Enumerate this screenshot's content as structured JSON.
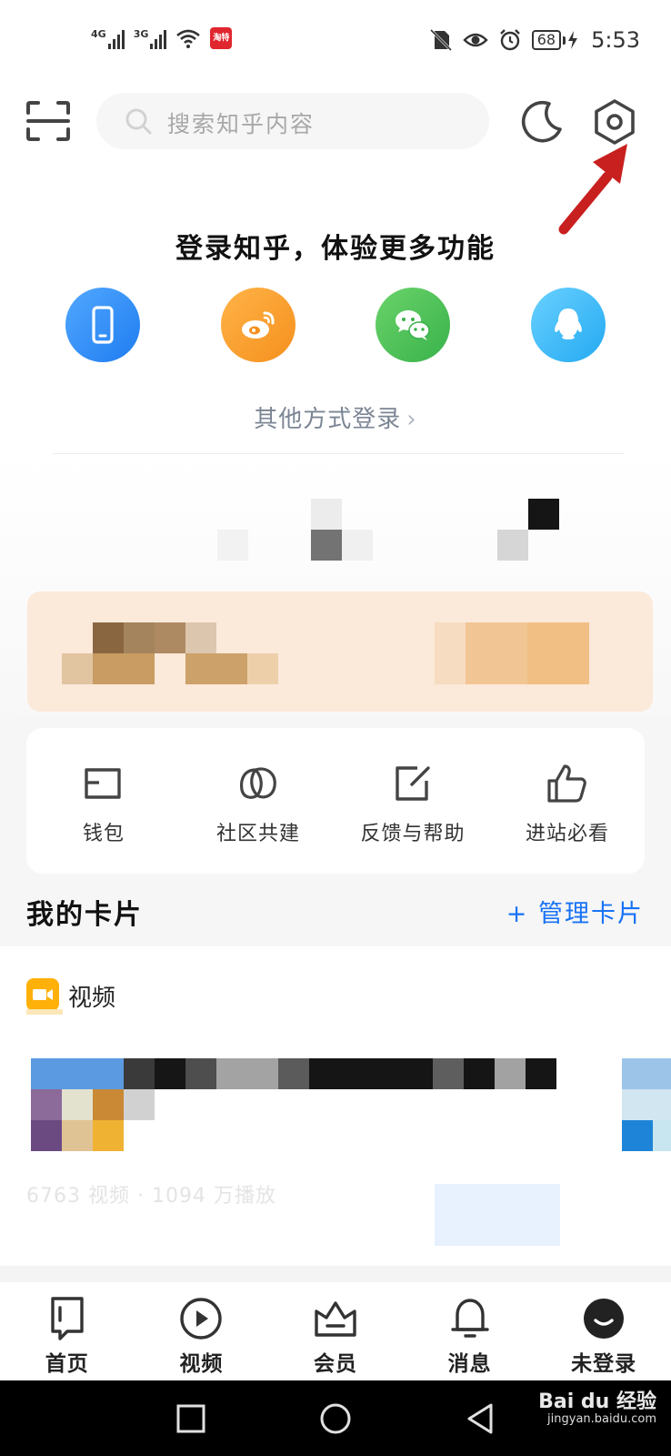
{
  "status_bar": {
    "network_1": "4G",
    "network_2": "3G",
    "app_notification": "淘特",
    "battery": "68",
    "time": "5:53"
  },
  "header": {
    "search_placeholder": "搜索知乎内容",
    "icons": [
      "scan-icon",
      "search-icon",
      "night-mode-icon",
      "settings-icon"
    ]
  },
  "login": {
    "title": "登录知乎，体验更多功能",
    "methods": [
      "phone-icon",
      "weibo-icon",
      "wechat-icon",
      "qq-icon"
    ],
    "other_login": "其他方式登录",
    "other_login_chevron": "›"
  },
  "quick_actions": [
    {
      "label": "钱包",
      "icon": "wallet-icon"
    },
    {
      "label": "社区共建",
      "icon": "community-icon"
    },
    {
      "label": "反馈与帮助",
      "icon": "feedback-icon"
    },
    {
      "label": "进站必看",
      "icon": "thumbs-up-icon"
    }
  ],
  "cards": {
    "title": "我的卡片",
    "manage": "+ 管理卡片",
    "video_card": {
      "label": "视频",
      "stats": "6763 视频 · 1094 万播放"
    }
  },
  "bottom_nav": [
    {
      "label": "首页",
      "icon": "home-icon"
    },
    {
      "label": "视频",
      "icon": "video-play-icon"
    },
    {
      "label": "会员",
      "icon": "crown-icon"
    },
    {
      "label": "消息",
      "icon": "bell-icon"
    },
    {
      "label": "未登录",
      "icon": "avatar-icon"
    }
  ],
  "watermark": {
    "brand": "Bai du 经验",
    "url": "jingyan.baidu.com"
  },
  "colors": {
    "accent_blue": "#1772f6",
    "annotation_red": "#c8201f",
    "video_badge": "#ffb10a"
  }
}
